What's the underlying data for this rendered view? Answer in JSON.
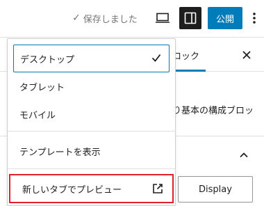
{
  "topbar": {
    "saved_status": "保存しました",
    "publish_label": "公開"
  },
  "sidebar": {
    "tab_label": "ロック",
    "description": "り基本の構成ブロッ",
    "display_button": "Display"
  },
  "preview_menu": {
    "items": [
      {
        "label": "デスクトップ",
        "selected": true
      },
      {
        "label": "タブレット",
        "selected": false
      },
      {
        "label": "モバイル",
        "selected": false
      }
    ],
    "template_label": "テンプレートを表示",
    "new_tab_label": "新しいタブでプレビュー"
  },
  "colors": {
    "accent": "#007cba",
    "highlight_border": "#e0212c",
    "dark_button": "#1e1e1e"
  },
  "icons": [
    "check-icon",
    "desktop-icon",
    "sidebar-toggle-icon",
    "more-vertical-icon",
    "close-icon",
    "chevron-up-icon",
    "external-link-icon"
  ]
}
